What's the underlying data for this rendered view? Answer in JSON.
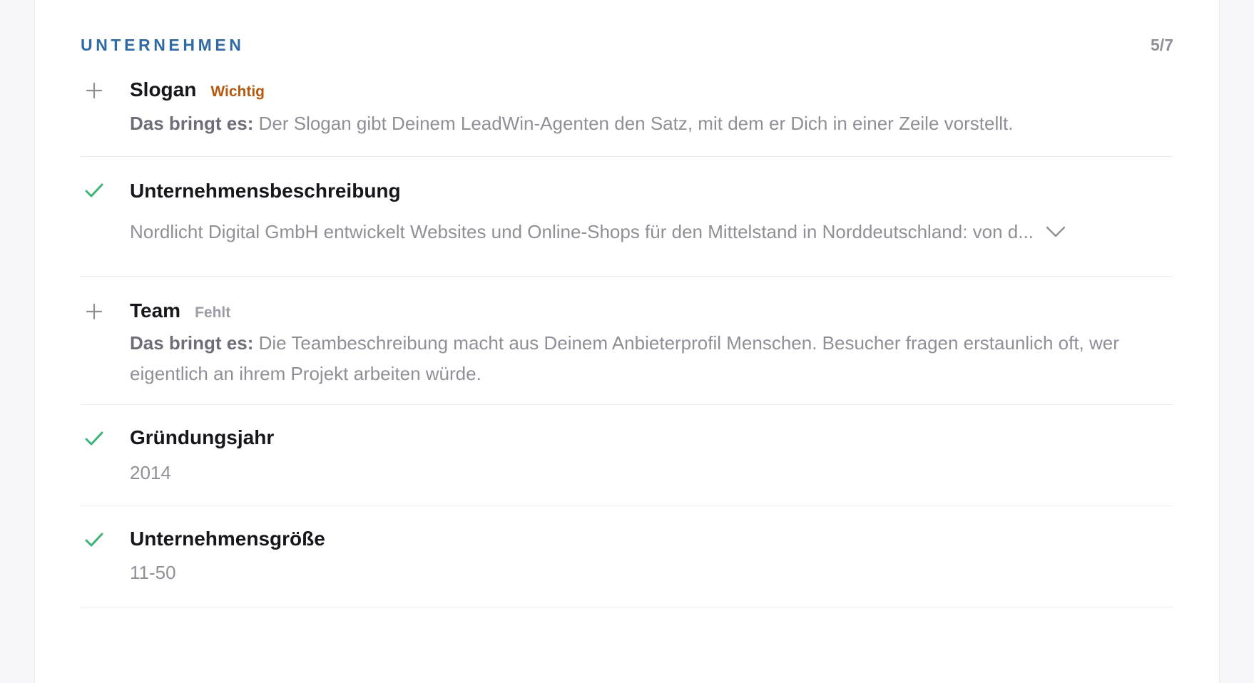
{
  "section": {
    "title": "UNTERNEHMEN",
    "count": "5/7"
  },
  "items": [
    {
      "label": "Slogan",
      "status_icon": "plus-icon",
      "badge": "Wichtig",
      "desc_lead": "Das bringt es:",
      "desc_text": "Der Slogan gibt Deinem LeadWin-Agenten den Satz, mit dem er Dich in einer Zeile vorstellt."
    },
    {
      "label": "Unternehmensbeschreibung",
      "status_icon": "check-icon",
      "preview": "Nordlicht Digital GmbH entwickelt Websites und Online-Shops für den Mittelstand in Norddeutschland: von d...",
      "expand_icon": "chevron-down-icon"
    },
    {
      "label": "Team",
      "status_icon": "plus-icon",
      "badge": "Fehlt",
      "desc_lead": "Das bringt es:",
      "desc_text": "Die Teambeschreibung macht aus Deinem Anbieterprofil Menschen. Besucher fragen erstaunlich oft, wer eigentlich an ihrem Projekt arbeiten würde."
    },
    {
      "label": "Gründungsjahr",
      "status_icon": "check-icon",
      "value": "2014"
    },
    {
      "label": "Unternehmensgröße",
      "status_icon": "check-icon",
      "value": "11-50"
    }
  ],
  "colors": {
    "accent": "#2f6aa3",
    "check": "#3fb37a",
    "badge_important": "#b35a10",
    "badge_missing": "#9c9ca6"
  }
}
